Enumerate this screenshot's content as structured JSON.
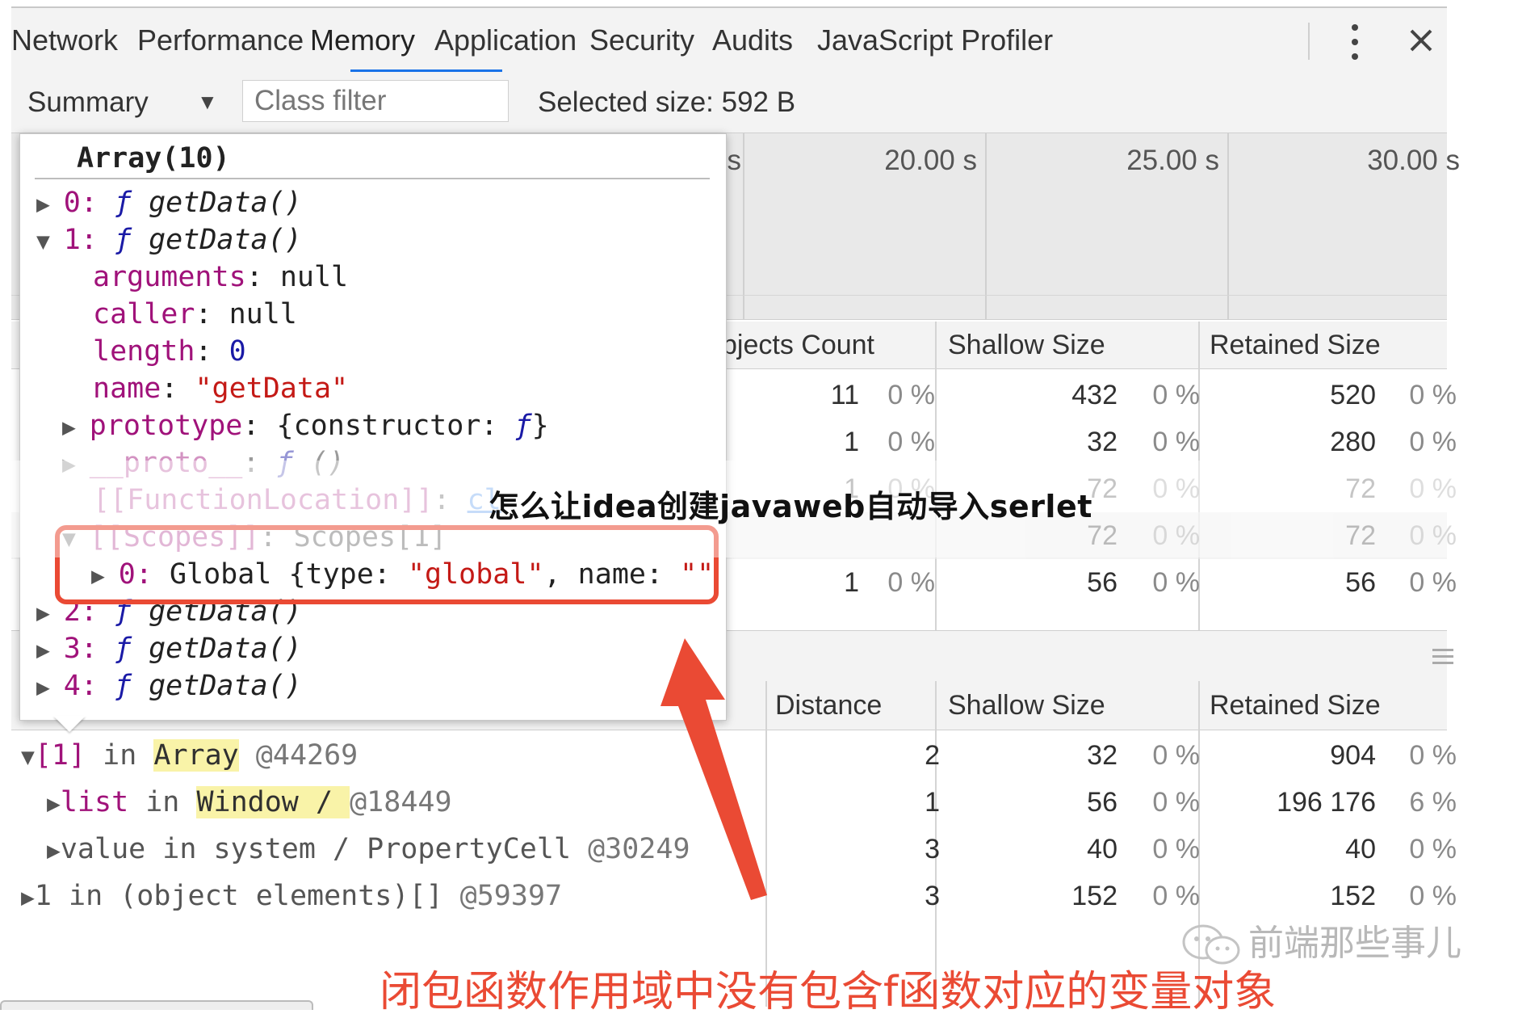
{
  "tabs": [
    "Network",
    "Performance",
    "Memory",
    "Application",
    "Security",
    "Audits",
    "JavaScript Profiler"
  ],
  "active_tab": "Memory",
  "toolbar": {
    "view_select": "Summary",
    "class_filter_placeholder": "Class filter",
    "selected_size": "Selected size: 592 B"
  },
  "timeline": {
    "labels": [
      "s",
      "20.00 s",
      "25.00 s",
      "30.00 s"
    ]
  },
  "upper_table": {
    "headers": {
      "objects_count": "bjects Count",
      "shallow_size": "Shallow Size",
      "retained_size": "Retained Size"
    },
    "rows": [
      {
        "count": "11",
        "count_pct": "0 %",
        "shallow": "432",
        "shallow_pct": "0 %",
        "retained": "520",
        "retained_pct": "0 %"
      },
      {
        "count": "1",
        "count_pct": "0 %",
        "shallow": "32",
        "shallow_pct": "0 %",
        "retained": "280",
        "retained_pct": "0 %"
      },
      {
        "count": "1",
        "count_pct": "0 %",
        "shallow": "72",
        "shallow_pct": "0 %",
        "retained": "72",
        "retained_pct": "0 %"
      },
      {
        "count": "",
        "count_pct": "",
        "shallow": "72",
        "shallow_pct": "0 %",
        "retained": "72",
        "retained_pct": "0 %"
      },
      {
        "count": "1",
        "count_pct": "0 %",
        "shallow": "56",
        "shallow_pct": "0 %",
        "retained": "56",
        "retained_pct": "0 %"
      }
    ]
  },
  "lower_table": {
    "headers": {
      "distance": "Distance",
      "shallow_size": "Shallow Size",
      "retained_size": "Retained Size"
    },
    "rows": [
      {
        "prop": "[1]",
        "in": " in ",
        "type": "Array",
        "id": " @44269",
        "distance": "2",
        "shallow": "32",
        "shallow_pct": "0 %",
        "retained": "904",
        "retained_pct": "0 %"
      },
      {
        "prop": "list",
        "in": " in ",
        "type": "Window / ",
        "id": "@18449",
        "distance": "1",
        "shallow": "56",
        "shallow_pct": "0 %",
        "retained": "196 176",
        "retained_pct": "6 %"
      },
      {
        "prop": "value",
        "in": " in system / PropertyCell",
        "type": "",
        "id": " @30249",
        "distance": "3",
        "shallow": "40",
        "shallow_pct": "0 %",
        "retained": "40",
        "retained_pct": "0 %"
      },
      {
        "prop": "1",
        "in": " in (object elements)[]",
        "type": "",
        "id": " @59397",
        "distance": "3",
        "shallow": "152",
        "shallow_pct": "0 %",
        "retained": "152",
        "retained_pct": "0 %"
      }
    ]
  },
  "popover": {
    "title": "Array(10)",
    "f": "ƒ",
    "fn_name": "getData()",
    "items": [
      "0:",
      "1:",
      "2:",
      "3:",
      "4:"
    ],
    "props": {
      "arguments": "arguments",
      "arguments_val": "null",
      "caller": "caller",
      "caller_val": "null",
      "length": "length",
      "length_val": "0",
      "name": "name",
      "name_val": "\"getData\"",
      "prototype": "prototype",
      "prototype_val": "{constructor: ",
      "proto": "__proto__",
      "proto_val": "()",
      "function_location": "[[FunctionLocation]]",
      "function_location_val": "cl",
      "scopes": "[[Scopes]]",
      "scopes_val": "Scopes[1]",
      "scope0_idx": "0:",
      "scope0_val_a": " Global {type: ",
      "scope0_type": "\"global\"",
      "scope0_val_b": ", name: ",
      "scope0_name": "\"\""
    }
  },
  "overlay_title": "怎么让idea创建javaweb自动导入serlet",
  "caption": "闭包函数作用域中没有包含f函数对应的变量对象",
  "watermark": "前端那些事儿",
  "colors": {
    "accent": "#1a73e8",
    "annotation": "#ea4a34"
  }
}
